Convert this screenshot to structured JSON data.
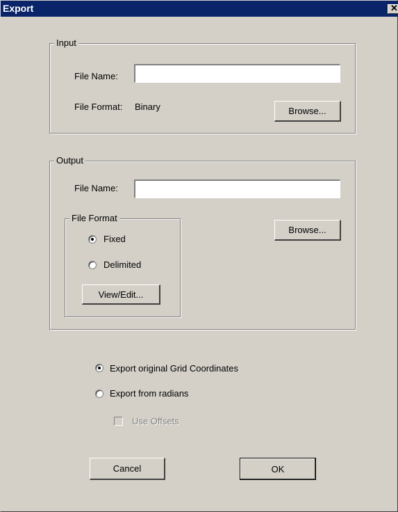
{
  "window": {
    "title": "Export",
    "close_glyph": "✕"
  },
  "input_group": {
    "legend": "Input",
    "file_name_label": "File Name:",
    "file_name_value": "",
    "file_format_label": "File Format:",
    "file_format_value": "Binary",
    "browse_label": "Browse..."
  },
  "output_group": {
    "legend": "Output",
    "file_name_label": "File Name:",
    "file_name_value": "",
    "browse_label": "Browse...",
    "file_format": {
      "legend": "File Format",
      "fixed_label": "Fixed",
      "delimited_label": "Delimited",
      "selected": "Fixed",
      "view_edit_label": "View/Edit..."
    }
  },
  "options": {
    "export_grid_label": "Export original Grid Coordinates",
    "export_radians_label": "Export from radians",
    "use_offsets_label": "Use Offsets",
    "selected": "Export original Grid Coordinates",
    "use_offsets_checked": false,
    "use_offsets_enabled": false
  },
  "buttons": {
    "cancel_label": "Cancel",
    "ok_label": "OK"
  }
}
